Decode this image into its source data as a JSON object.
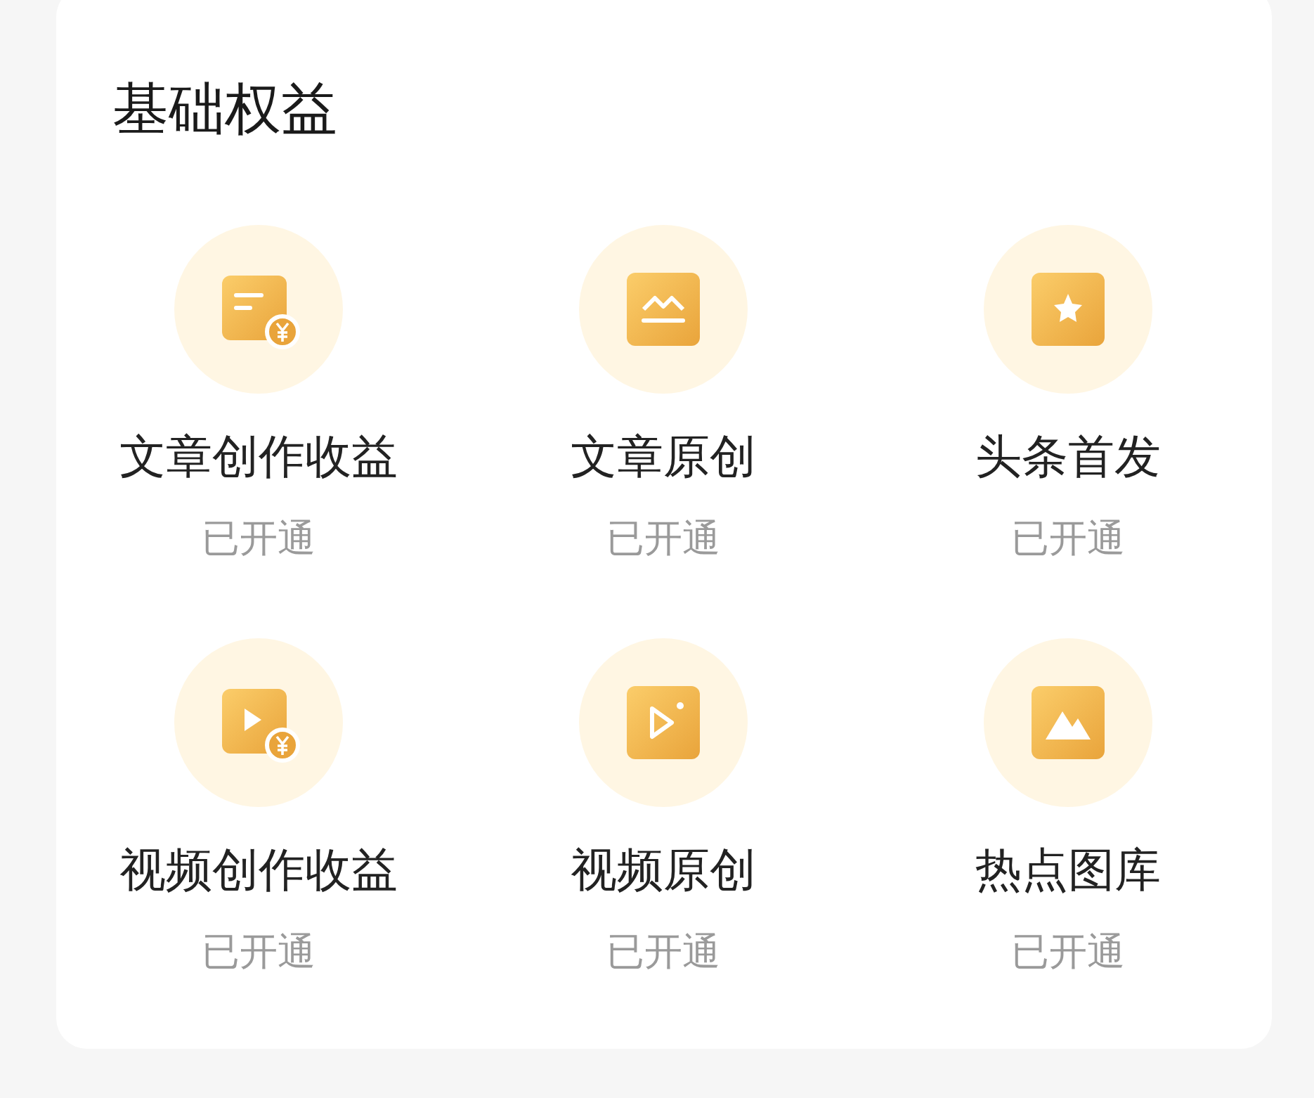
{
  "section": {
    "title": "基础权益"
  },
  "items": [
    {
      "label": "文章创作收益",
      "status": "已开通"
    },
    {
      "label": "文章原创",
      "status": "已开通"
    },
    {
      "label": "头条首发",
      "status": "已开通"
    },
    {
      "label": "视频创作收益",
      "status": "已开通"
    },
    {
      "label": "视频原创",
      "status": "已开通"
    },
    {
      "label": "热点图库",
      "status": "已开通"
    }
  ]
}
